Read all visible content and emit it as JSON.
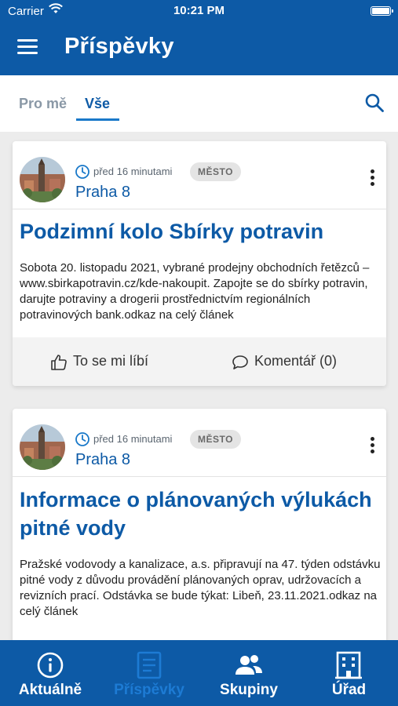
{
  "status_bar": {
    "carrier": "Carrier",
    "time": "10:21 PM"
  },
  "header": {
    "title": "Příspěvky",
    "menu_icon": "hamburger-menu-icon"
  },
  "tabs": [
    {
      "label": "Pro mě",
      "active": false
    },
    {
      "label": "Vše",
      "active": true
    }
  ],
  "search_icon": "search-icon",
  "posts": [
    {
      "time_ago": "před 16 minutami",
      "tag": "MĚSTO",
      "author": "Praha 8",
      "title": "Podzimní kolo Sbírky potravin",
      "text": "Sobota 20. listopadu 2021, vybrané prodejny obchodních řetězců – www.sbirkapotravin.cz/kde-nakoupit. Zapojte se do sbírky potravin, darujte potraviny a drogerii prostřednictvím regionálních potravinových bank.odkaz na celý článek",
      "like_label": "To se mi líbí",
      "comment_label": "Komentář (0)"
    },
    {
      "time_ago": "před 16 minutami",
      "tag": "MĚSTO",
      "author": "Praha 8",
      "title": "Informace o plánovaných výlukách pitné vody",
      "text": "Pražské vodovody a kanalizace, a.s. připravují na 47. týden odstávku pitné vody z důvodu provádění plánovaných oprav, udržovacích a revizních prací. Odstávka se bude týkat: Libeň, 23.11.2021.odkaz na celý článek"
    }
  ],
  "bottom_nav": [
    {
      "label": "Aktuálně",
      "icon": "info-icon",
      "active": false
    },
    {
      "label": "Příspěvky",
      "icon": "document-icon",
      "active": true
    },
    {
      "label": "Skupiny",
      "icon": "group-icon",
      "active": false
    },
    {
      "label": "Úřad",
      "icon": "building-icon",
      "active": false
    }
  ],
  "colors": {
    "primary": "#0d5aa6",
    "accent": "#1a79c9"
  }
}
